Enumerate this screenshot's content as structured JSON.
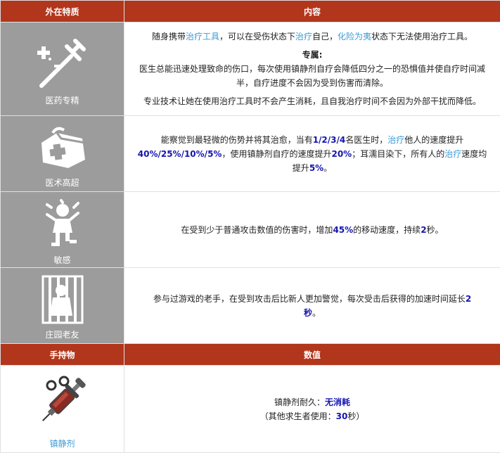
{
  "header": {
    "col1": "外在特质",
    "col2": "内容"
  },
  "traits": [
    {
      "icon": "syringe-cross-icon",
      "name": "医药专精",
      "p1": {
        "a": "随身携带",
        "b": "治疗工具",
        "c": "，可以在受伤状态下",
        "d": "治疗",
        "e": "自己，",
        "f": "化险为夷",
        "g": "状态下无法使用治疗工具。"
      },
      "subtitle": "专属:",
      "p2": "医生总能迅速处理致命的伤口，每次使用镇静剂自疗会降低四分之一的恐惧值并使自疗时间减半，自疗进度不会因为受到伤害而清除。",
      "p3": "专业技术让她在使用治疗工具时不会产生消耗，且自我治疗时间不会因为外部干扰而降低。"
    },
    {
      "icon": "medical-bag-icon",
      "name": "医术高超",
      "p1": {
        "a": "能察觉到最轻微的伤势并将其治愈，当有",
        "b": "1/2/3/4",
        "c": "名医生时，",
        "d": "治疗",
        "e": "他人的速度提升",
        "f": "40%/25%/10%/5%",
        "g": "，使用镇静剂自疗的速度提升",
        "h": "20%",
        "i": "；耳濡目染下，所有人的",
        "j": "治疗",
        "k": "速度均提升",
        "l": "5%",
        "m": "。"
      }
    },
    {
      "icon": "frightened-person-icon",
      "name": "敏感",
      "p1": {
        "a": "在受到少于普通攻击数值的伤害时，增加",
        "b": "45%",
        "c": "的移动速度，持续",
        "d": "2",
        "e": "秒。"
      }
    },
    {
      "icon": "caged-person-icon",
      "name": "庄园老友",
      "p1": {
        "a": "参与过游戏的老手，在受到攻击后比新人更加警觉，每次受击后获得的加速时间延长",
        "b": "2",
        "c": "秒",
        "d": "。"
      }
    }
  ],
  "header2": {
    "col1": "手持物",
    "col2": "数值"
  },
  "item": {
    "icon": "sedative-syringe-icon",
    "name": "镇静剂",
    "line1": {
      "a": "镇静剂耐久：",
      "b": "无消耗"
    },
    "line2": {
      "a": "（其他求生者使用：",
      "b": "30",
      "c": "秒）"
    }
  },
  "colors": {
    "header_bg": "#b2361c",
    "icon_bg": "#9c9c9c",
    "link": "#3b9bd6",
    "highlight": "#1515b0"
  }
}
